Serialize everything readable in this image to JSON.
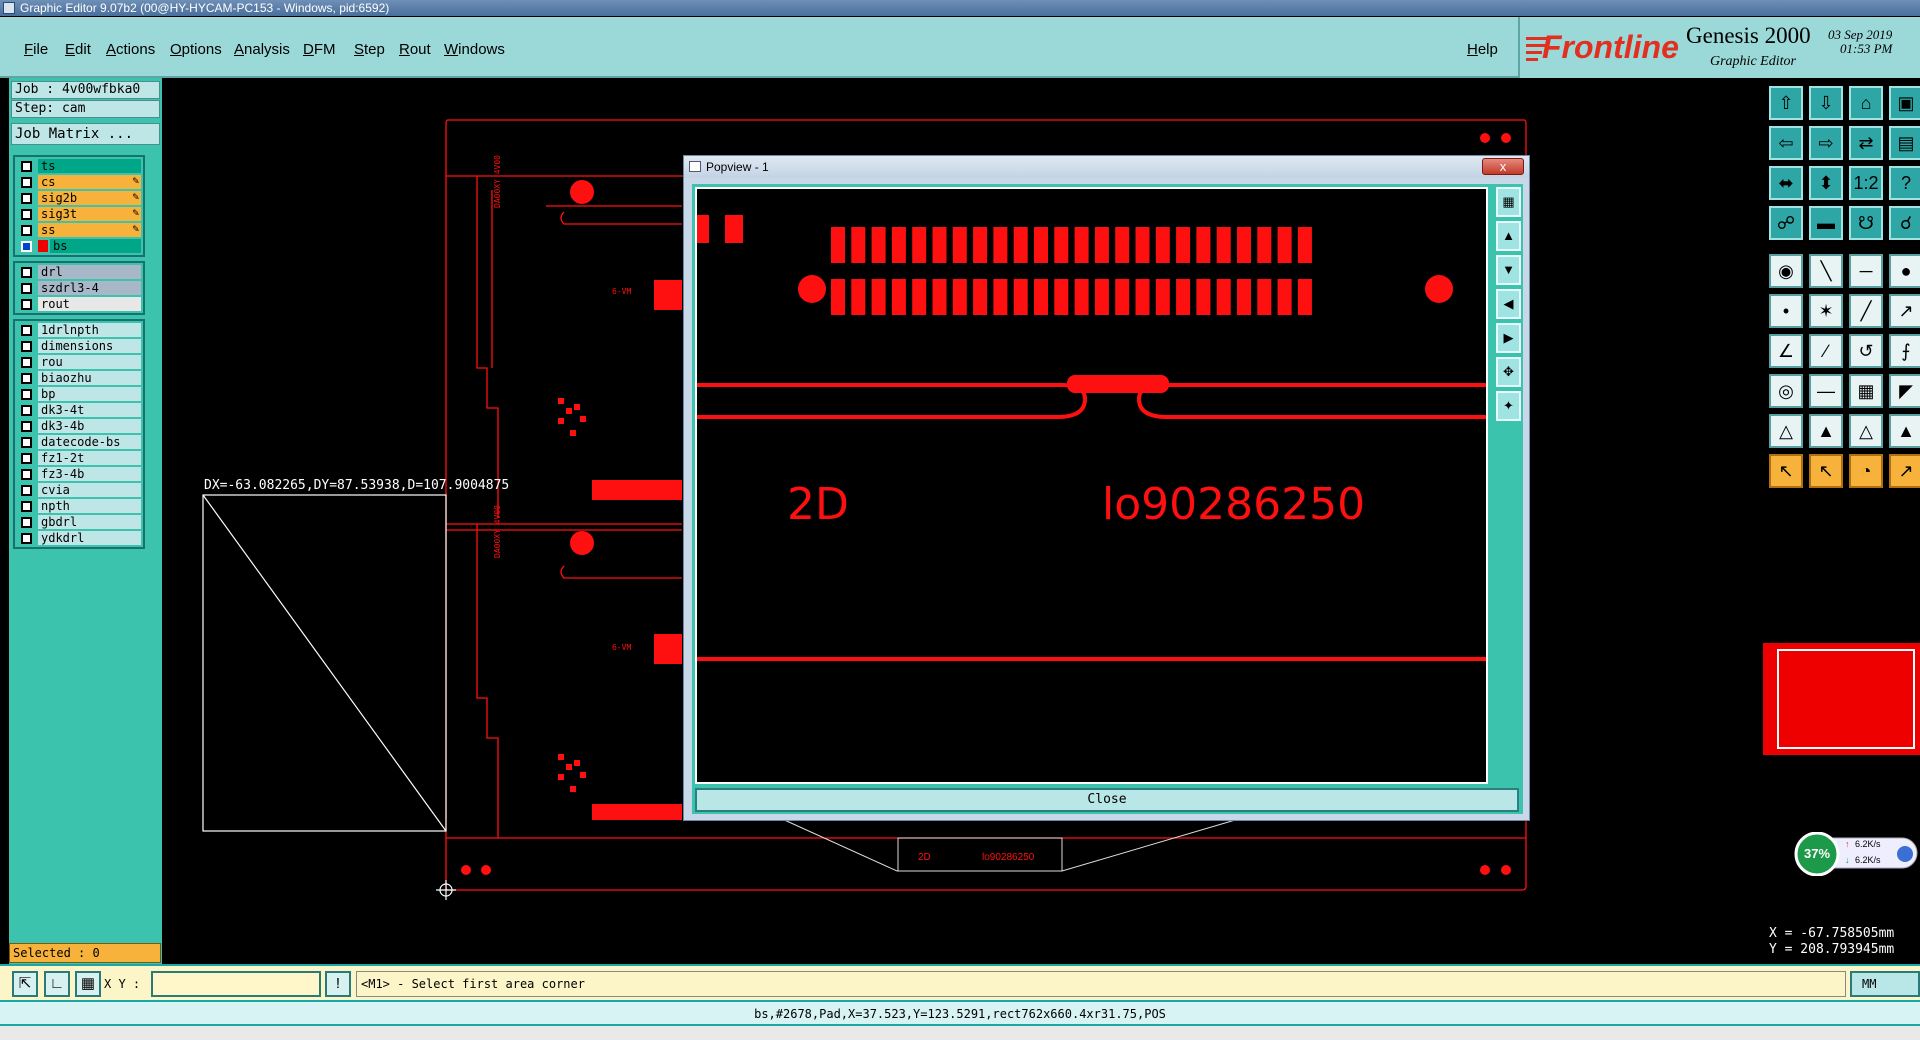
{
  "window": {
    "title": "Graphic Editor 9.07b2 (00@HY-HYCAM-PC153 - Windows, pid:6592)"
  },
  "menu": {
    "items": [
      "File",
      "Edit",
      "Actions",
      "Options",
      "Analysis",
      "DFM",
      "Step",
      "Rout",
      "Windows"
    ],
    "help": "Help"
  },
  "brand": {
    "logo": "Frontline",
    "product": "Genesis 2000",
    "subtitle": "Graphic Editor",
    "date": "03 Sep 2019",
    "time": "01:53 PM"
  },
  "job": {
    "job_label": "Job : 4v00wfbka0",
    "step_label": "Step: cam",
    "matrix_button": "Job Matrix ..."
  },
  "layers": {
    "group1": [
      {
        "name": "ts",
        "kind": "ts",
        "checked": false
      },
      {
        "name": "cs",
        "kind": "sig",
        "checked": false
      },
      {
        "name": "sig2b",
        "kind": "sig",
        "checked": false
      },
      {
        "name": "sig3t",
        "kind": "sig",
        "checked": false
      },
      {
        "name": "ss",
        "kind": "sig",
        "checked": false
      },
      {
        "name": "bs",
        "kind": "bs",
        "checked": true
      }
    ],
    "group2": [
      {
        "name": "drl",
        "kind": "drl",
        "checked": false
      },
      {
        "name": "szdrl3-4",
        "kind": "drl",
        "checked": false
      },
      {
        "name": "rout",
        "kind": "rout",
        "checked": false
      }
    ],
    "group3": [
      {
        "name": "1drlnpth",
        "kind": "plain",
        "checked": false
      },
      {
        "name": "dimensions",
        "kind": "plain",
        "checked": false
      },
      {
        "name": "rou",
        "kind": "plain",
        "checked": false
      },
      {
        "name": "biaozhu",
        "kind": "plain",
        "checked": false
      },
      {
        "name": "bp",
        "kind": "plain",
        "checked": false
      },
      {
        "name": "dk3-4t",
        "kind": "plain",
        "checked": false
      },
      {
        "name": "dk3-4b",
        "kind": "plain",
        "checked": false
      },
      {
        "name": "datecode-bs",
        "kind": "plain",
        "checked": false
      },
      {
        "name": "fz1-2t",
        "kind": "plain",
        "checked": false
      },
      {
        "name": "fz3-4b",
        "kind": "plain",
        "checked": false
      },
      {
        "name": "cvia",
        "kind": "plain",
        "checked": false
      },
      {
        "name": "npth",
        "kind": "plain",
        "checked": false
      },
      {
        "name": "gbdrl",
        "kind": "plain",
        "checked": false
      },
      {
        "name": "ydkdrl",
        "kind": "plain",
        "checked": false
      }
    ]
  },
  "selected": "Selected : 0",
  "measure": "DX=-63.082265,DY=87.53938,D=107.9004875",
  "popup": {
    "title": "Popview - 1",
    "close_x": "x",
    "close_button": "Close",
    "text_left": "2D",
    "text_right": "lo90286250"
  },
  "board_small_text": {
    "left": "2D",
    "right": "lo90286250"
  },
  "network": {
    "percent": "37%",
    "up": "6.2K/s",
    "down": "6.2K/s"
  },
  "coords": {
    "x": "X = -67.758505mm",
    "y": "Y = 208.793945mm"
  },
  "command": {
    "xy_label": "X Y :",
    "xy_value": "",
    "prompt": "<M1> - Select first area corner",
    "units": "MM"
  },
  "info": "bs,#2678,Pad,X=37.523,Y=123.5291,rect762x660.4xr31.75,POS",
  "colors": {
    "accent": "#3cc3ae",
    "feature": "#ff0000",
    "menu": "#9bd8d8",
    "highlight": "#f6b23a"
  }
}
